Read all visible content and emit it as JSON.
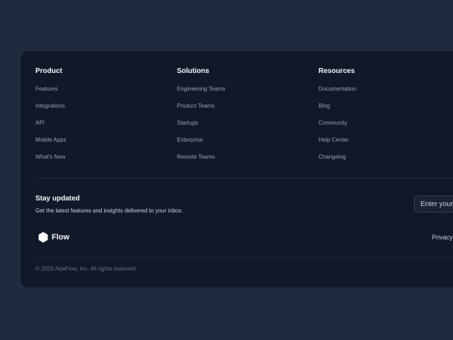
{
  "footer": {
    "columns": [
      {
        "title": "Product",
        "links": [
          "Features",
          "Integrations",
          "API",
          "Mobile Apps",
          "What's New"
        ]
      },
      {
        "title": "Solutions",
        "links": [
          "Engineering Teams",
          "Product Teams",
          "Startups",
          "Enterprise",
          "Remote Teams"
        ]
      },
      {
        "title": "Resources",
        "links": [
          "Documentation",
          "Blog",
          "Community",
          "Help Center",
          "Changelog"
        ]
      }
    ],
    "newsletter": {
      "title": "Stay updated",
      "subtitle": "Get the latest features and insights delivered to your inbox.",
      "email_placeholder": "Enter your email"
    },
    "brand": {
      "name": "Flow",
      "logo_icon": "hexagon-icon"
    },
    "privacy_link": "Privacy",
    "copyright": "© 2025 AdaFlow, Inc. All rights reserved."
  },
  "colors": {
    "background": "#1e2a3d",
    "card": "#111827",
    "heading": "#f8fafc",
    "link": "#94a3b8",
    "muted": "#64748b"
  }
}
